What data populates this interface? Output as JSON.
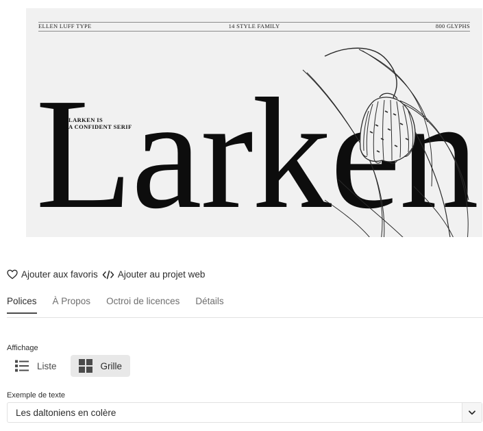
{
  "specimen": {
    "meta_left": "ELLEN LUFF TYPE",
    "meta_center": "14 STYLE FAMILY",
    "meta_right": "800 GLYPHS",
    "tagline_line1": "LARKEN IS",
    "tagline_line2": "A CONFIDENT SERIF",
    "big_word": "Larken"
  },
  "actions": {
    "favorite_label": "Ajouter aux favoris",
    "web_project_label": "Ajouter au projet web"
  },
  "tabs": [
    {
      "label": "Polices",
      "active": true
    },
    {
      "label": "À Propos",
      "active": false
    },
    {
      "label": "Octroi de licences",
      "active": false
    },
    {
      "label": "Détails",
      "active": false
    }
  ],
  "view": {
    "label": "Affichage",
    "list_label": "Liste",
    "grid_label": "Grille",
    "selected": "grid"
  },
  "sample_text": {
    "label": "Exemple de texte",
    "value": "Les daltoniens en colère"
  },
  "colors": {
    "accent": "#1473e6",
    "selected_bg": "#e8e8e8",
    "specimen_bg": "#f1f1f1"
  }
}
